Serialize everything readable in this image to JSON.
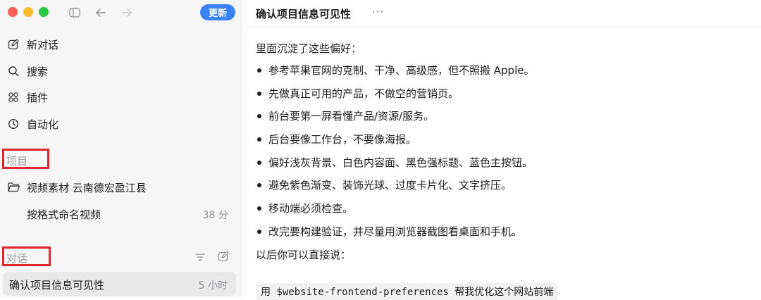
{
  "window": {
    "update_label": "更新"
  },
  "sidebar": {
    "nav": [
      {
        "label": "新对话",
        "icon": "edit-icon"
      },
      {
        "label": "搜索",
        "icon": "search-icon"
      },
      {
        "label": "插件",
        "icon": "grid-icon"
      },
      {
        "label": "自动化",
        "icon": "clock-icon"
      }
    ],
    "projects_header": "项目",
    "project": {
      "label": "视频素材 云南德宏盈江县",
      "icon": "folder-icon"
    },
    "project_thread": {
      "label": "按格式命名视频",
      "time": "38 分"
    },
    "conversations_header": "对话",
    "active_conversation": {
      "label": "确认项目信息可见性",
      "time": "5 小时"
    }
  },
  "main": {
    "title": "确认项目信息可见性",
    "more": "···",
    "intro": "里面沉淀了这些偏好：",
    "bullets": [
      "参考苹果官网的克制、干净、高级感，但不照搬 Apple。",
      "先做真正可用的产品，不做空的营销页。",
      "前台要第一屏看懂产品/资源/服务。",
      "后台要像工作台，不要像海报。",
      "偏好浅灰背景、白色内容面、黑色强标题、蓝色主按钮。",
      "避免紫色渐变、装饰光球、过度卡片化、文字挤压。",
      "移动端必须检查。",
      "改完要构建验证，并尽量用浏览器截图看桌面和手机。"
    ],
    "outro": "以后你可以直接说：",
    "code": "用 $website-frontend-preferences 帮我优化这个网站前端"
  },
  "colors": {
    "accent": "#3b82f6",
    "highlight_box": "#e0262d"
  }
}
